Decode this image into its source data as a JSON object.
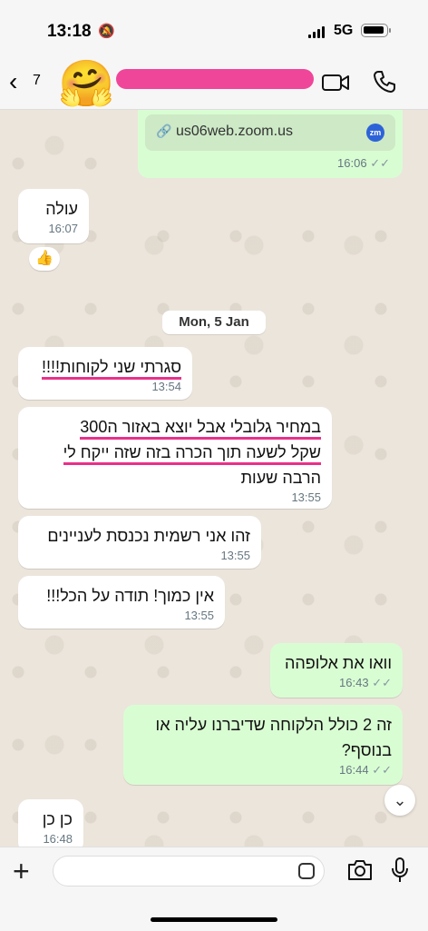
{
  "status_bar": {
    "time": "13:18",
    "network": "5G"
  },
  "header": {
    "back_count": "7"
  },
  "link_message": {
    "url": "us06web.zoom.us",
    "logo_text": "zm",
    "time": "16:06"
  },
  "messages": [
    {
      "text": "עולה",
      "time": "16:07",
      "reaction": "👍"
    },
    {
      "text": "סגרתי שני לקוחות!!!!",
      "time": "13:54"
    },
    {
      "line1": "במחיר גלובלי אבל יוצא באזור ה300",
      "line2": "שקל לשעה תוך הכרה בזה שזה ייקח לי",
      "line3": "הרבה שעות",
      "time": "13:55"
    },
    {
      "text": "זהו אני רשמית נכנסת לעניינים",
      "time": "13:55"
    },
    {
      "text": "אין כמוך! תודה על הכל!!!",
      "time": "13:55"
    },
    {
      "text": "וואו את אלופהה",
      "time": "16:43"
    },
    {
      "line1": "זה 2 כולל הלקוחה שדיברנו עליה או",
      "line2": "בנוסף?",
      "time": "16:44"
    },
    {
      "text": "כן כן",
      "time": "16:48"
    }
  ],
  "date_separator": "Mon, 5 Jan",
  "icons": {
    "back": "chevron-left",
    "video": "video-camera",
    "call": "phone",
    "plus": "plus",
    "sticker": "sticker",
    "camera": "camera",
    "mic": "microphone",
    "scroll_down": "chevron-down"
  },
  "colors": {
    "outgoing": "#d9fdd3",
    "incoming": "#ffffff",
    "highlight": "#e8318a"
  }
}
